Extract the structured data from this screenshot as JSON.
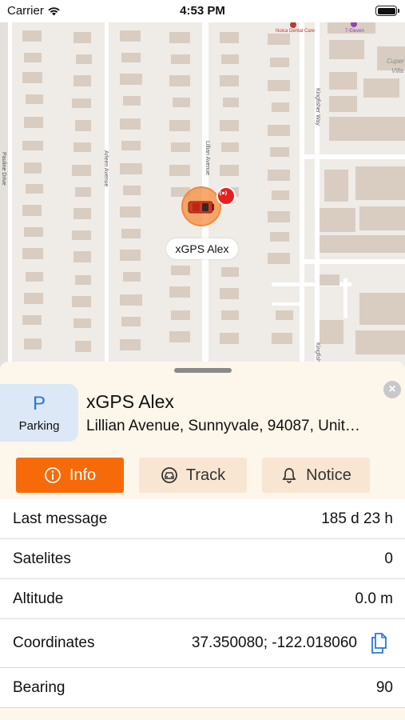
{
  "status_bar": {
    "carrier": "Carrier",
    "time": "4:53 PM",
    "wifi_icon": "wifi-icon",
    "battery_icon": "battery-icon"
  },
  "map": {
    "streets": [
      "Pauline Drive",
      "Arleen Avenue",
      "Lillian Avenue",
      "Kingfisher Way",
      "Kingfish"
    ],
    "pois": [
      "Noica Dental Care",
      "7-Eleven"
    ],
    "city_partial": [
      "Cuper",
      "Villa"
    ],
    "marker_name": "xGPS Alex",
    "marker_color": "#f08a3a",
    "signal_color": "#e52020"
  },
  "sheet": {
    "parking_letter": "P",
    "parking_label": "Parking",
    "title": "xGPS Alex",
    "address": "Lillian Avenue, Sunnyvale, 94087, Unit…",
    "close_icon": "close-icon"
  },
  "tabs": [
    {
      "label": "Info",
      "icon": "info-icon",
      "active": true
    },
    {
      "label": "Track",
      "icon": "car-icon",
      "active": false
    },
    {
      "label": "Notice",
      "icon": "bell-icon",
      "active": false
    }
  ],
  "details": [
    {
      "label": "Last message",
      "value": "185 d 23 h"
    },
    {
      "label": "Satelites",
      "value": "0"
    },
    {
      "label": "Altitude",
      "value": "0.0 m"
    },
    {
      "label": "Coordinates",
      "value": "37.350080; -122.018060"
    },
    {
      "label": "Bearing",
      "value": "90"
    }
  ],
  "colors": {
    "accent": "#f66a0a",
    "tab_inactive": "#f8e6d2",
    "parking_bg": "#dce8f6",
    "parking_text": "#2a79d2",
    "copy_icon": "#2a79d2"
  }
}
